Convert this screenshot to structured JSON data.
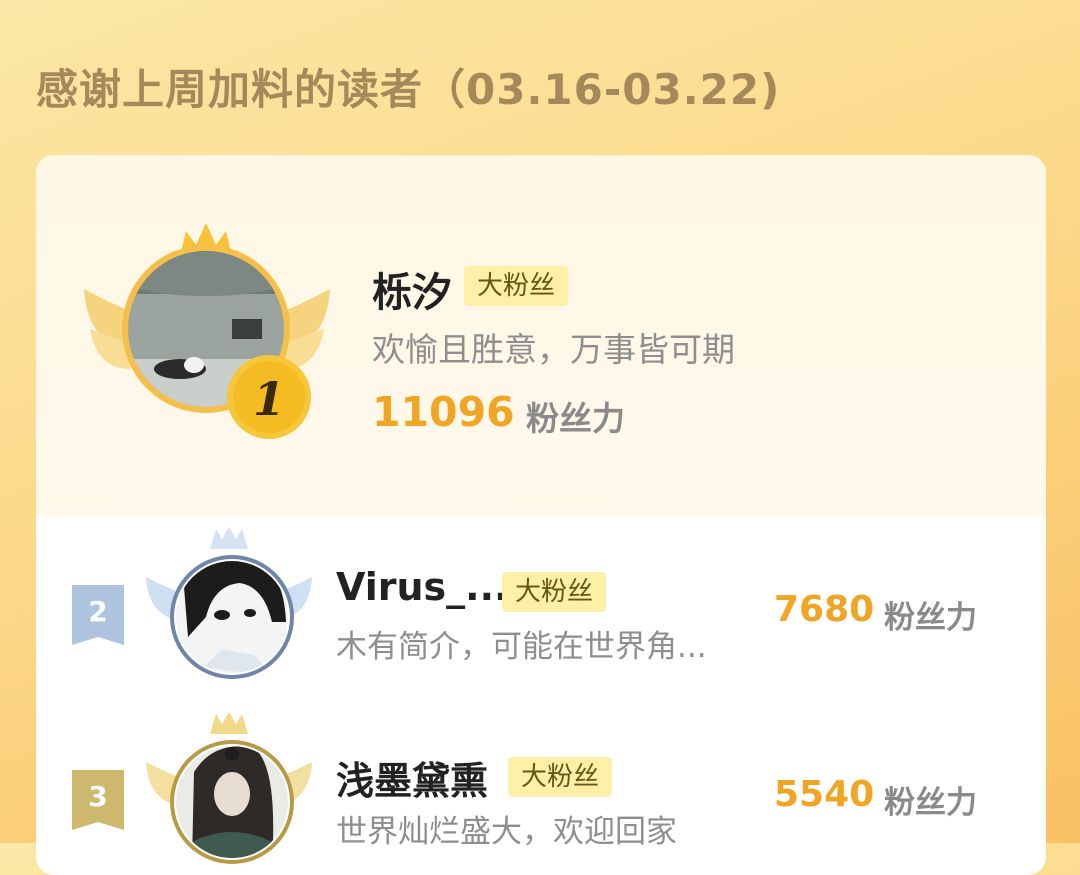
{
  "header": {
    "title": "感谢上周加料的读者（03.16-03.22)"
  },
  "leaders": [
    {
      "rank": "1",
      "name": "栎汐",
      "badge": "大粉丝",
      "bio": "欢愉且胜意，万事皆可期",
      "score": "11096",
      "unit": "粉丝力"
    },
    {
      "rank": "2",
      "name": "Virus_...",
      "badge": "大粉丝",
      "bio": "木有简介，可能在世界角...",
      "score": "7680",
      "unit": "粉丝力"
    },
    {
      "rank": "3",
      "name": "浅墨黛熏",
      "badge": "大粉丝",
      "bio": "世界灿烂盛大，欢迎回家",
      "score": "5540",
      "unit": "粉丝力"
    }
  ],
  "colors": {
    "gold": "#f0a524",
    "silver": "#a9bfd9",
    "bronze": "#c9b46a",
    "badge_bg": "#fdf1a8",
    "title": "#a6895b"
  },
  "icons": {
    "crown": "crown-icon",
    "wings": "wings-icon",
    "rank_medal": "rank-medal-icon"
  }
}
